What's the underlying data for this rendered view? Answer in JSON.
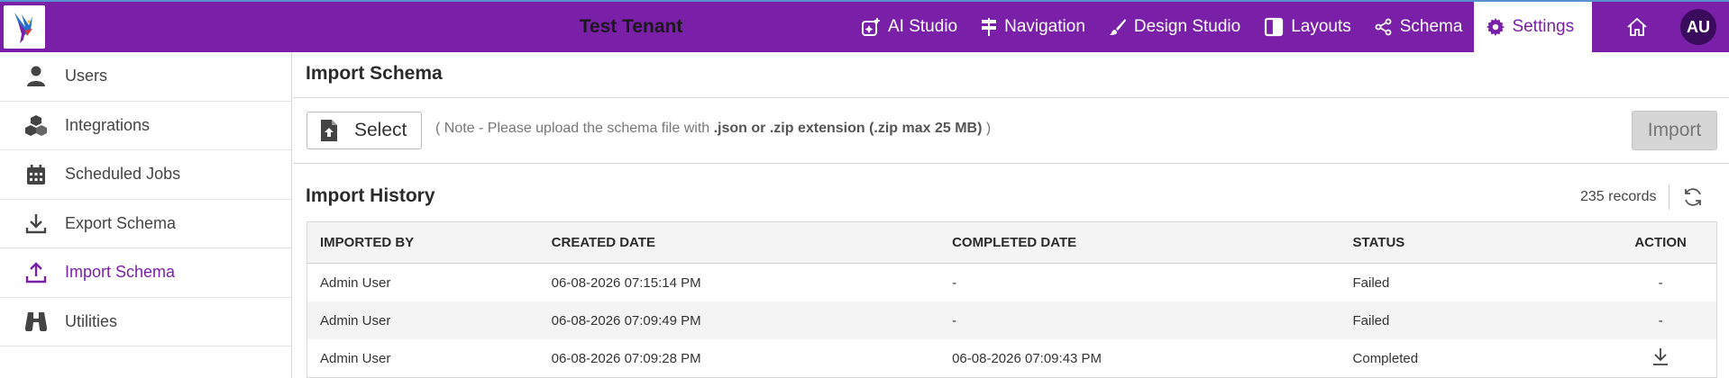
{
  "header": {
    "tenant": "Test Tenant",
    "nav": [
      {
        "label": "AI Studio",
        "icon": "ai-studio-icon"
      },
      {
        "label": "Navigation",
        "icon": "signpost-icon"
      },
      {
        "label": "Design Studio",
        "icon": "brush-icon"
      },
      {
        "label": "Layouts",
        "icon": "layout-icon"
      },
      {
        "label": "Schema",
        "icon": "share-icon"
      },
      {
        "label": "Settings",
        "icon": "gear-icon",
        "active": true
      }
    ],
    "avatar": "AU",
    "accent": "#7a1fa8"
  },
  "sidebar": {
    "items": [
      {
        "label": "Users",
        "icon": "user-icon"
      },
      {
        "label": "Integrations",
        "icon": "cubes-icon"
      },
      {
        "label": "Scheduled Jobs",
        "icon": "calendar-icon"
      },
      {
        "label": "Export Schema",
        "icon": "download-icon"
      },
      {
        "label": "Import Schema",
        "icon": "upload-icon",
        "active": true
      },
      {
        "label": "Utilities",
        "icon": "binoculars-icon"
      }
    ]
  },
  "main": {
    "title": "Import Schema",
    "select_label": "Select",
    "note_prefix": "( Note - Please upload the schema file with ",
    "note_bold": ".json or .zip extension (.zip max 25 MB)",
    "note_suffix": " )",
    "import_label": "Import",
    "history_title": "Import History",
    "records": "235 records",
    "table": {
      "columns": [
        "IMPORTED BY",
        "CREATED DATE",
        "COMPLETED DATE",
        "STATUS",
        "ACTION"
      ],
      "rows": [
        {
          "by": "Admin User",
          "created": "06-08-2026 07:15:14 PM",
          "completed": "-",
          "status": "Failed",
          "action": "-"
        },
        {
          "by": "Admin User",
          "created": "06-08-2026 07:09:49 PM",
          "completed": "-",
          "status": "Failed",
          "action": "-"
        },
        {
          "by": "Admin User",
          "created": "06-08-2026 07:09:28 PM",
          "completed": "06-08-2026 07:09:43 PM",
          "status": "Completed",
          "action": "download-icon"
        }
      ]
    }
  }
}
